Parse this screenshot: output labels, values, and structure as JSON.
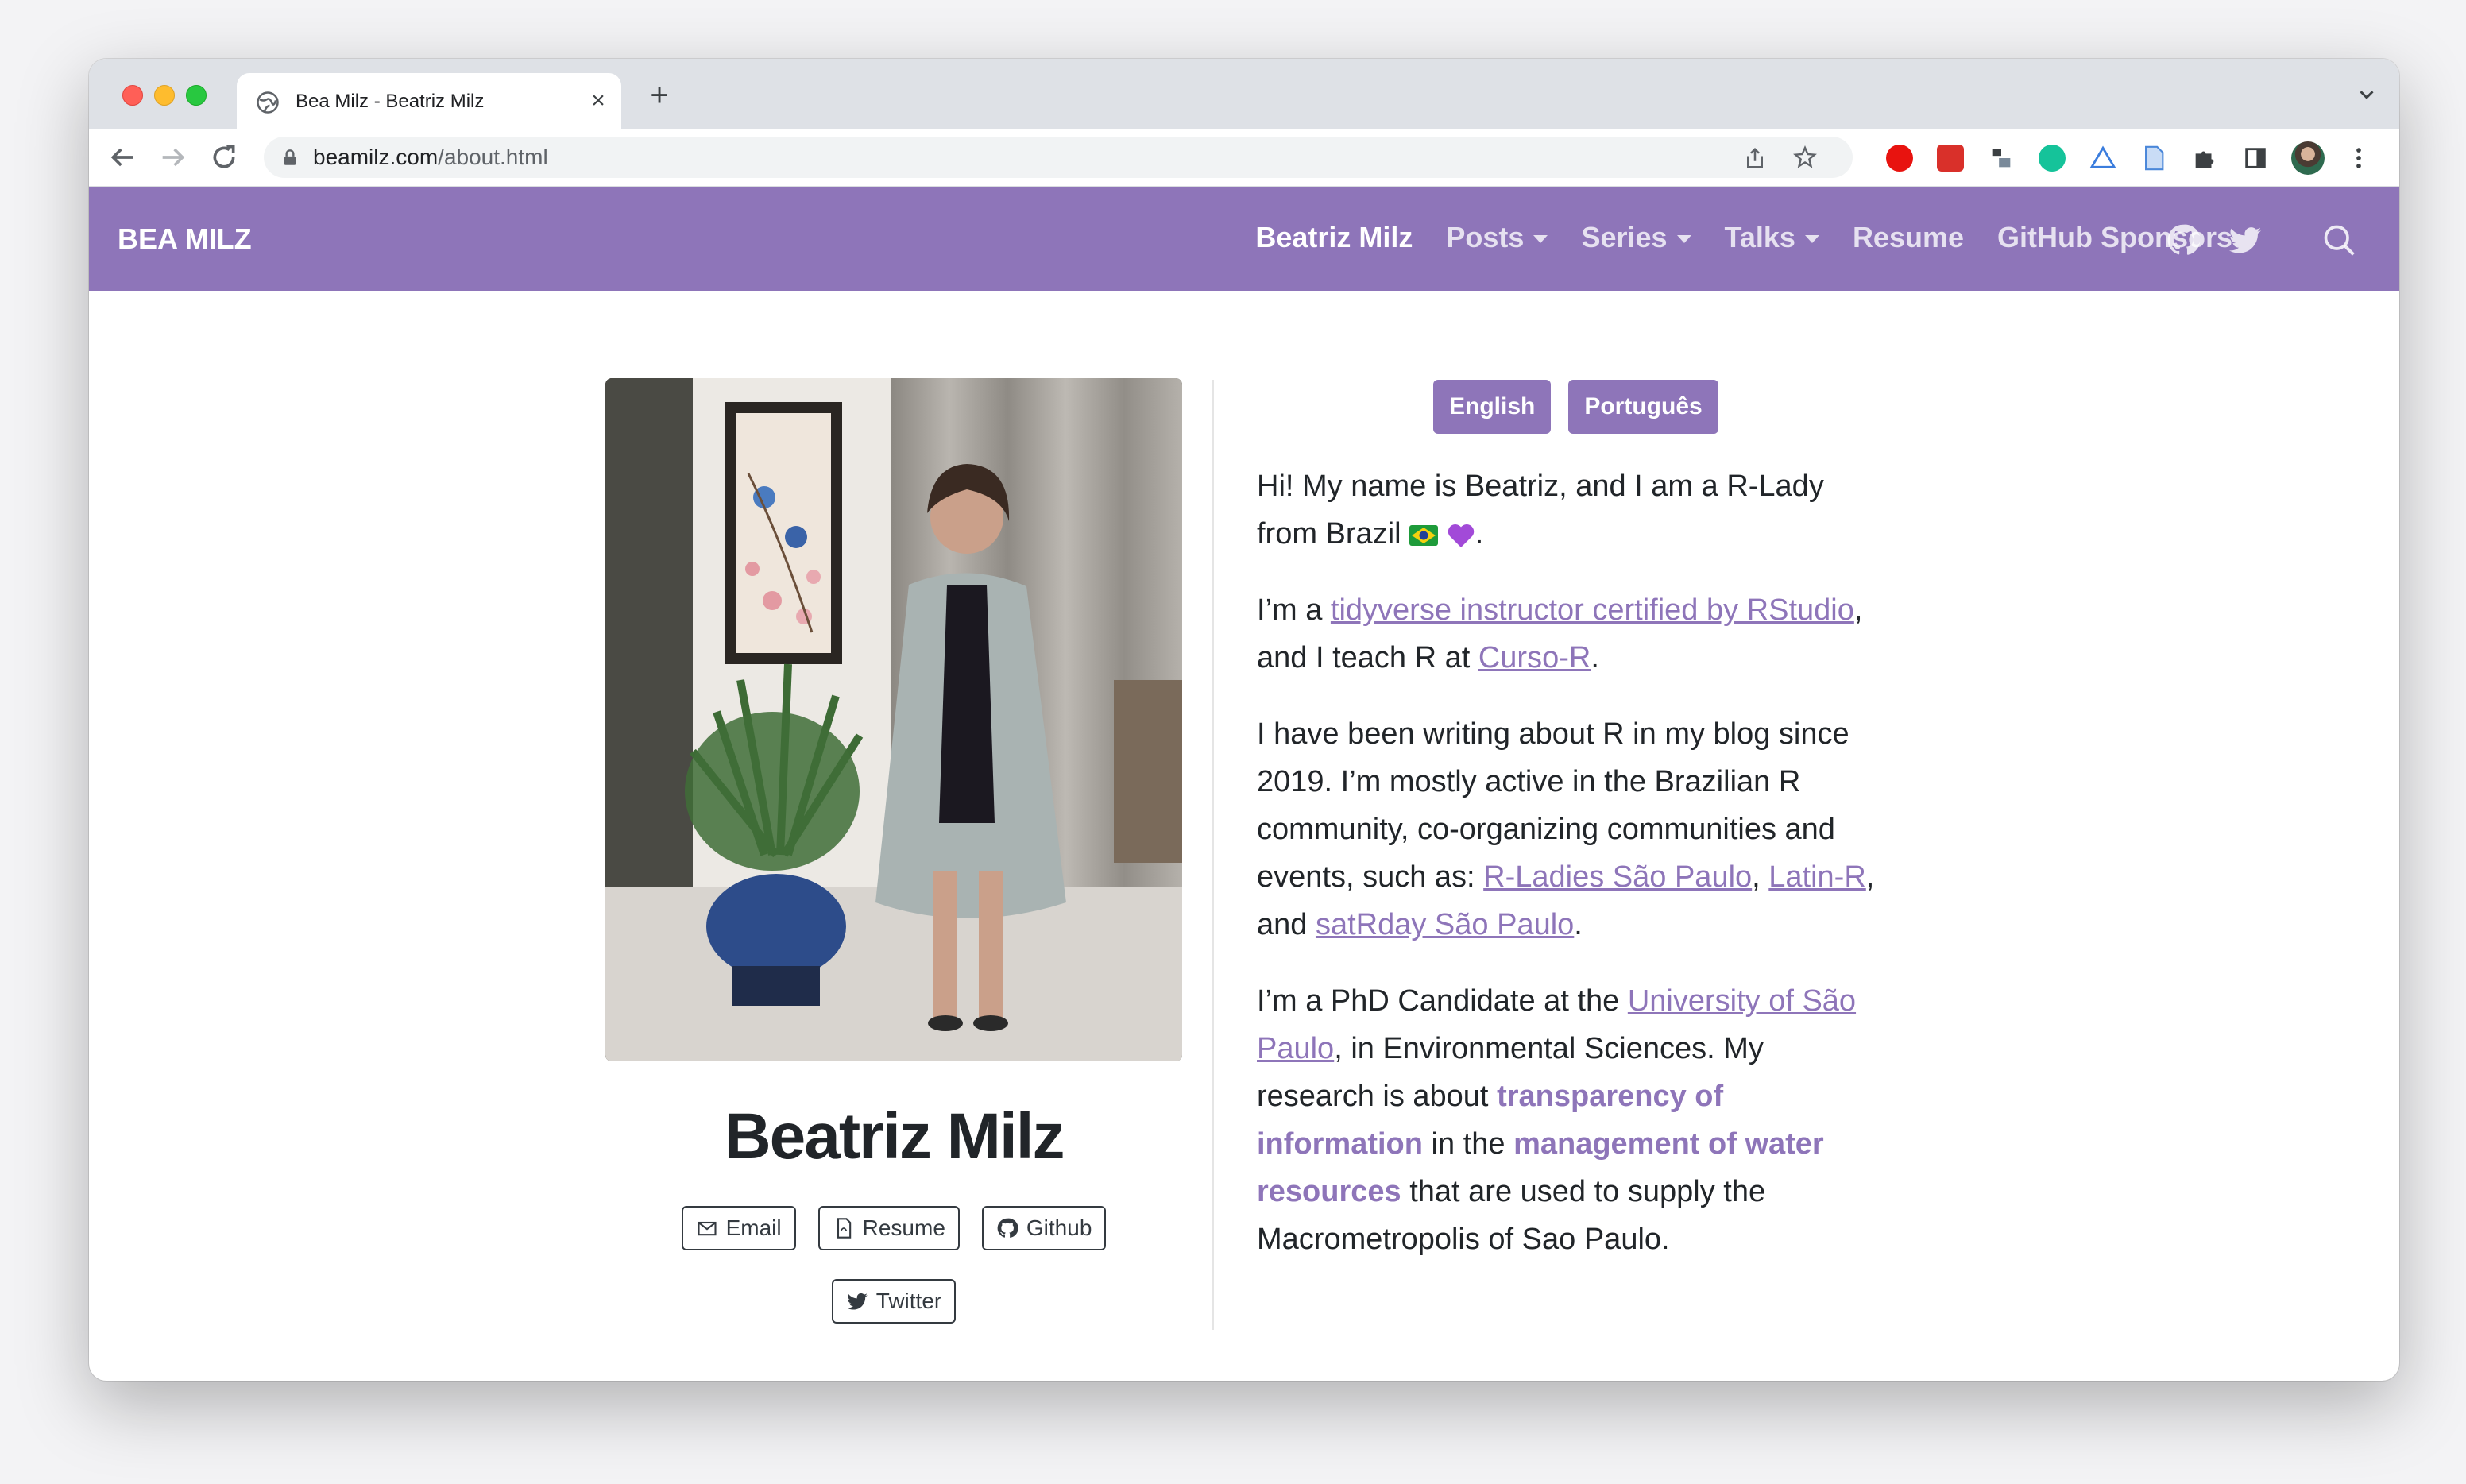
{
  "browser": {
    "tab_title": "Bea Milz - Beatriz Milz",
    "url_host": "beamilz.com",
    "url_path": "/about.html"
  },
  "site": {
    "brand": "BEA MILZ",
    "nav": [
      "Beatriz Milz",
      "Posts",
      "Series",
      "Talks",
      "Resume",
      "GitHub Sponsors"
    ],
    "accent_color": "#8e75b9"
  },
  "profile": {
    "name": "Beatriz Milz",
    "buttons": {
      "email": "Email",
      "resume": "Resume",
      "github": "Github",
      "twitter": "Twitter"
    }
  },
  "languages": {
    "english": "English",
    "portuguese": "Português"
  },
  "bio": {
    "p1_text": "Hi! My name is Beatriz, and I am a R-Lady from Brazil",
    "p1_end": ".",
    "p2_a": "I’m a ",
    "p2_link1": "tidyverse instructor certified by RStudio",
    "p2_b": ", and I teach R at ",
    "p2_link2": "Curso-R",
    "p2_c": ".",
    "p3_a": "I have been writing about R in my blog since 2019. I’m mostly active in the Brazilian R community, co-organizing communities and events, such as: ",
    "p3_link1": "R-Ladies São Paulo",
    "p3_sep1": ", ",
    "p3_link2": "Latin-R",
    "p3_sep2": ", and ",
    "p3_link3": "satRday São Paulo",
    "p3_end": ".",
    "p4_a": "I’m a PhD Candidate at the ",
    "p4_link1": "University of São Paulo",
    "p4_b": ", in Environmental Sciences. My research is about ",
    "p4_bold1": "transparency of information",
    "p4_c": " in the ",
    "p4_bold2": "management of water resources",
    "p4_d": " that are used to supply the Macrometropolis of Sao Paulo."
  }
}
